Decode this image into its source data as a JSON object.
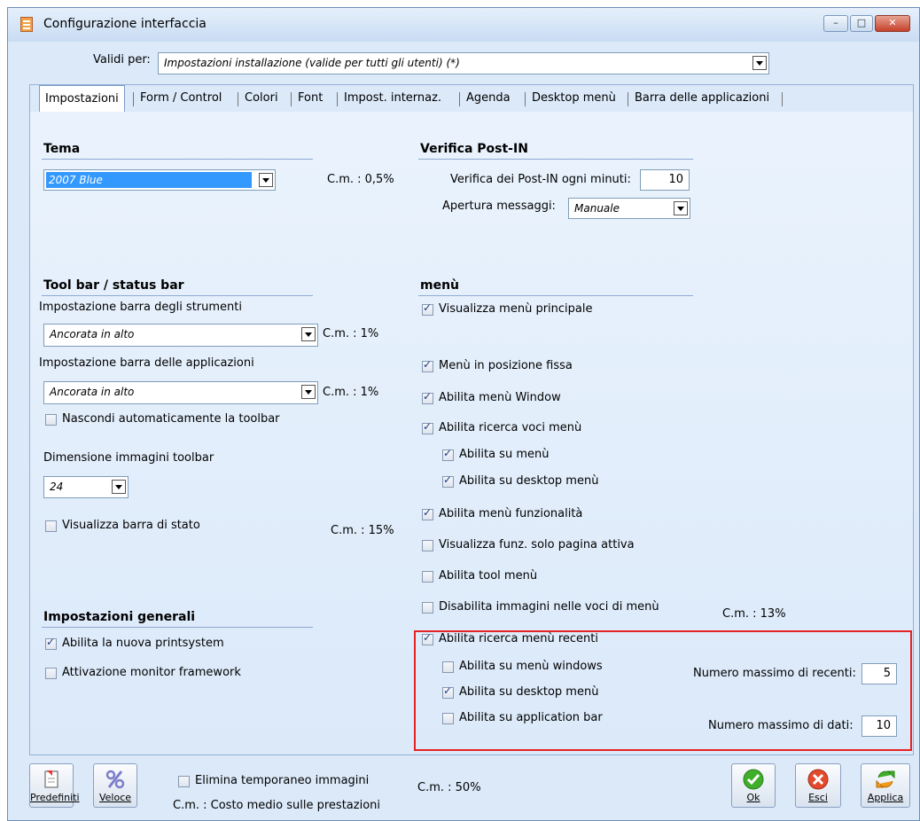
{
  "window": {
    "title": "Configurazione interfaccia",
    "controls": {
      "minimize": "–",
      "maximize": "□",
      "close": "✕"
    }
  },
  "valid_for": {
    "label": "Validi per:",
    "value": "Impostazioni installazione (valide per tutti gli utenti) (*)"
  },
  "tabs": [
    "Impostazioni",
    "Form / Control",
    "Colori",
    "Font",
    "Impost. internaz.",
    "Agenda",
    "Desktop menù",
    "Barra delle applicazioni"
  ],
  "active_tab": "Impostazioni",
  "tema": {
    "title": "Tema",
    "value": "2007 Blue",
    "cost": "C.m. : 0,5%"
  },
  "postin": {
    "title": "Verifica Post-IN",
    "minutes_label": "Verifica dei Post-IN ogni minuti:",
    "minutes_value": "10",
    "open_label": "Apertura messaggi:",
    "open_value": "Manuale"
  },
  "toolbar": {
    "title": "Tool bar / status bar",
    "tools_label": "Impostazione barra degli strumenti",
    "tools_value": "Ancorata in alto",
    "tools_cost": "C.m. : 1%",
    "apps_label": "Impostazione barra delle applicazioni",
    "apps_value": "Ancorata in alto",
    "apps_cost": "C.m. : 1%",
    "autohide_label": "Nascondi automaticamente la toolbar",
    "autohide_checked": false,
    "size_label": "Dimensione immagini toolbar",
    "size_value": "24",
    "statusbar_label": "Visualizza barra di stato",
    "statusbar_checked": false,
    "statusbar_cost": "C.m. : 15%"
  },
  "general": {
    "title": "Impostazioni generali",
    "printsystem_label": "Abilita la nuova printsystem",
    "printsystem_checked": true,
    "monitor_label": "Attivazione monitor framework",
    "monitor_checked": false
  },
  "menu": {
    "title": "menù",
    "items": [
      {
        "label": "Visualizza menù principale",
        "checked": true
      },
      {
        "label": "Menù in posizione fissa",
        "checked": true
      },
      {
        "label": "Abilita menù Window",
        "checked": true
      },
      {
        "label": "Abilita ricerca voci menù",
        "checked": true
      },
      {
        "label": "Abilita su menù",
        "checked": true
      },
      {
        "label": "Abilita su desktop menù",
        "checked": true
      },
      {
        "label": "Abilita menù funzionalità",
        "checked": true
      },
      {
        "label": "Visualizza funz. solo pagina attiva",
        "checked": false
      },
      {
        "label": "Abilita tool menù",
        "checked": false
      },
      {
        "label": "Disabilita immagini nelle voci di menù",
        "checked": false
      }
    ],
    "cost": "C.m. : 13%"
  },
  "recent": {
    "enable_label": "Abilita ricerca menù recenti",
    "enable_checked": true,
    "windows_label": "Abilita su menù windows",
    "windows_checked": false,
    "desktop_label": "Abilita su desktop menù",
    "desktop_checked": true,
    "appbar_label": "Abilita su application bar",
    "appbar_checked": false,
    "max_recent_label": "Numero massimo di recenti:",
    "max_recent_value": "5",
    "max_data_label": "Numero massimo di dati:",
    "max_data_value": "10"
  },
  "footer": {
    "btn_defaults": "Predefiniti",
    "btn_fast": "Veloce",
    "delete_temp_label": "Elimina temporaneo immagini",
    "delete_temp_checked": false,
    "legend": "C.m. : Costo medio sulle prestazioni",
    "cost": "C.m. : 50%",
    "btn_ok": "Ok",
    "btn_exit": "Esci",
    "btn_apply": "Applica"
  }
}
